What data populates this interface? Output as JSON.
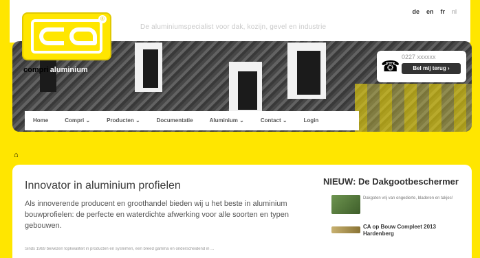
{
  "header": {
    "tagline": "De aluminiumspecialist voor dak, kozijn, gevel en industrie",
    "languages": [
      "de",
      "en",
      "fr",
      "nl"
    ],
    "brand_compri": "compri",
    "brand_aluminium": "aluminium"
  },
  "callbox": {
    "number": "0227 xxxxxx",
    "button_label": "Bel mij terug ›"
  },
  "nav": {
    "items": [
      "Home",
      "Compri ⌄",
      "Producten ⌄",
      "Documentatie",
      "Aluminium ⌄",
      "Contact ⌄",
      "Login"
    ]
  },
  "breadcrumb": {
    "home_icon": "home-icon",
    "text": "⌂"
  },
  "main": {
    "title": "Innovator in aluminium profielen",
    "lead": "Als innoverende producent en groothandel bieden wij u het beste in aluminium bouwprofielen: de perfecte en waterdichte afwerking voor alle soorten en typen gebouwen.",
    "small": "Sinds 1969 bewezen topkwaliteit in producten en systemen, een breed gamma en onderscheidend in ..."
  },
  "aside": {
    "title": "NIEUW: De Dakgootbeschermer",
    "items": [
      {
        "text": "Dakgoten vrij van ongedierte, bladeren en takjes!"
      },
      {
        "text": "CA op Bouw Compleet 2013 Hardenberg"
      }
    ]
  },
  "colors": {
    "accent": "#ffe600",
    "dark": "#3a3a3a"
  }
}
